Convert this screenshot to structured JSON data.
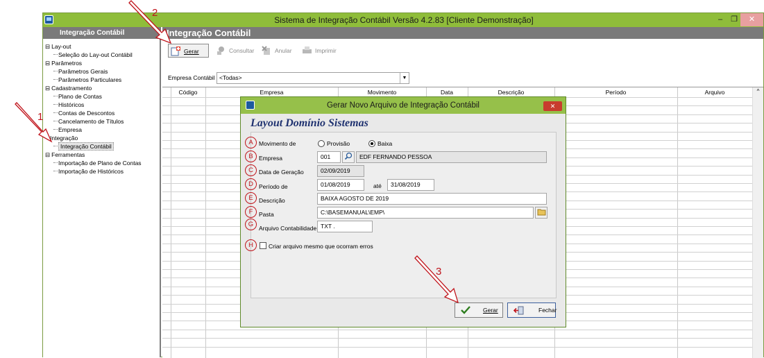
{
  "window": {
    "title": "Sistema de Integração Contábil Versão 4.2.83 [Cliente Demonstração]",
    "min_label": "–",
    "restore_label": "❐",
    "close_label": "✕"
  },
  "left_panel": {
    "header": "Integração Contábil",
    "tree": [
      {
        "label": "Lay-out",
        "prefix": "⊟",
        "selected": false
      },
      {
        "label": "Seleção do Lay-out Contábil",
        "prefix": "",
        "selected": false
      },
      {
        "label": "Parâmetros",
        "prefix": "⊟",
        "selected": false
      },
      {
        "label": "Parâmetros Gerais",
        "prefix": "",
        "selected": false
      },
      {
        "label": "Parâmetros Particulares",
        "prefix": "",
        "selected": false
      },
      {
        "label": "Cadastramento",
        "prefix": "⊟",
        "selected": false
      },
      {
        "label": "Plano de Contas",
        "prefix": "",
        "selected": false
      },
      {
        "label": "Históricos",
        "prefix": "",
        "selected": false
      },
      {
        "label": "Contas de Descontos",
        "prefix": "",
        "selected": false
      },
      {
        "label": "Cancelamento de Títulos",
        "prefix": "",
        "selected": false
      },
      {
        "label": "Empresa",
        "prefix": "",
        "selected": false
      },
      {
        "label": "Integração",
        "prefix": "",
        "selected": false
      },
      {
        "label": "Integração Contábil",
        "prefix": "",
        "selected": true
      },
      {
        "label": "Ferramentas",
        "prefix": "⊟",
        "selected": false
      },
      {
        "label": "Importação de Plano de Contas",
        "prefix": "",
        "selected": false
      },
      {
        "label": "Importação de Históricos",
        "prefix": "",
        "selected": false
      }
    ]
  },
  "content": {
    "header": "Integração Contábil",
    "toolbar": {
      "gerar": "Gerar",
      "consultar": "Consultar",
      "anular": "Anular",
      "imprimir": "Imprimir"
    },
    "empresa_label": "Empresa Contábil",
    "empresa_value": "<Todas>",
    "columns": [
      "Código",
      "Empresa",
      "Movimento",
      "Data",
      "Descrição",
      "Período",
      "Arquivo"
    ]
  },
  "dialog": {
    "title": "Gerar Novo Arquivo de Integração Contábil",
    "close_label": "✕",
    "heading": "Layout Domínio Sistemas",
    "movimento_label": "Movimento de",
    "provisao_label": "Provisão",
    "baixa_label": "Baixa",
    "movimento_selected": "Baixa",
    "empresa_label": "Empresa",
    "empresa_code": "001",
    "empresa_name": "EDF FERNANDO PESSOA",
    "data_geracao_label": "Data de Geração",
    "data_geracao": "02/09/2019",
    "periodo_label": "Período de",
    "periodo_de": "01/08/2019",
    "ate_label": "até",
    "periodo_ate": "31/08/2019",
    "descricao_label": "Descrição",
    "descricao": "BAIXA AGOSTO DE 2019",
    "pasta_label": "Pasta",
    "pasta": "C:\\BASEMANUAL\\EMP\\",
    "arquivo_label": "Arquivo Contabilidade",
    "arquivo": "TXT    .",
    "criar_label": "Criar arquivo mesmo que ocorram erros",
    "criar_checked": false,
    "gerar_label": "Gerar",
    "fechar_label": "Fechar"
  },
  "annotations": {
    "circles": [
      "A",
      "B",
      "C",
      "D",
      "E",
      "F",
      "G",
      "H"
    ],
    "callouts": [
      "1",
      "2",
      "3"
    ],
    "color": "#c0141b"
  },
  "colors": {
    "titlebar": "#8fbd3a",
    "panel_header": "#7a7a7a",
    "dialog_heading": "#1f3270"
  }
}
